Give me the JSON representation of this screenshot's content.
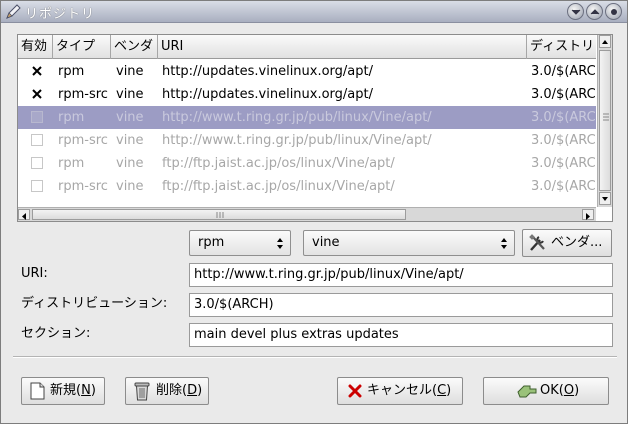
{
  "window": {
    "title": "リポジトリ"
  },
  "table": {
    "columns": [
      "有効",
      "タイプ",
      "ベンダ",
      "URI",
      "ディストリ"
    ],
    "rows": [
      {
        "enabled": true,
        "type": "rpm",
        "vendor": "vine",
        "uri": "http://updates.vinelinux.org/apt/",
        "dist": "3.0/$(ARCH",
        "state": "normal"
      },
      {
        "enabled": true,
        "type": "rpm-src",
        "vendor": "vine",
        "uri": "http://updates.vinelinux.org/apt/",
        "dist": "3.0/$(ARCH",
        "state": "normal"
      },
      {
        "enabled": false,
        "type": "rpm",
        "vendor": "vine",
        "uri": "http://www.t.ring.gr.jp/pub/linux/Vine/apt/",
        "dist": "3.0/$(ARCH",
        "state": "selected"
      },
      {
        "enabled": false,
        "type": "rpm-src",
        "vendor": "vine",
        "uri": "http://www.t.ring.gr.jp/pub/linux/Vine/apt/",
        "dist": "3.0/$(ARCH",
        "state": "disabled"
      },
      {
        "enabled": false,
        "type": "rpm",
        "vendor": "vine",
        "uri": "ftp://ftp.jaist.ac.jp/os/linux/Vine/apt/",
        "dist": "3.0/$(ARCH",
        "state": "disabled"
      },
      {
        "enabled": false,
        "type": "rpm-src",
        "vendor": "vine",
        "uri": "ftp://ftp.jaist.ac.jp/os/linux/Vine/apt/",
        "dist": "3.0/$(ARCH",
        "state": "disabled"
      }
    ]
  },
  "editor": {
    "type_value": "rpm",
    "vendor_value": "vine",
    "vendor_button": "ベンダ...",
    "uri_label": "URI:",
    "uri_value": "http://www.t.ring.gr.jp/pub/linux/Vine/apt/",
    "dist_label": "ディストリビューション:",
    "dist_value": "3.0/$(ARCH)",
    "section_label": "セクション:",
    "section_value": "main devel plus extras updates"
  },
  "buttons": {
    "new_prefix": "新規(",
    "new_key": "N",
    "new_suffix": ")",
    "delete_prefix": "削除(",
    "delete_key": "D",
    "delete_suffix": ")",
    "cancel_prefix": "キャンセル(",
    "cancel_key": "C",
    "cancel_suffix": ")",
    "ok_prefix": "OK(",
    "ok_key": "O",
    "ok_suffix": ")"
  }
}
